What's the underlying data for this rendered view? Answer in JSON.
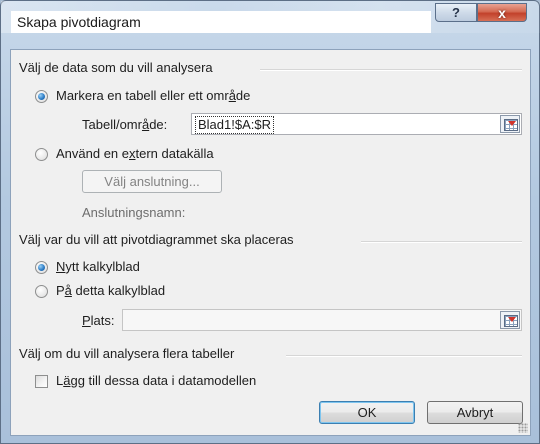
{
  "window": {
    "title": "Skapa pivotdiagram",
    "help_glyph": "?",
    "close_glyph": "x"
  },
  "data_group": {
    "label": "Välj de data som du vill analysera",
    "option_select": {
      "pre": "Markera en tabell eller ett omr",
      "accel": "å",
      "post": "de",
      "selected": true
    },
    "table_range": {
      "pre": "Tabell/omr",
      "accel": "å",
      "post": "de:",
      "value": "Blad1!$A:$R"
    },
    "option_external": {
      "pre": "Använd en e",
      "accel": "x",
      "post": "tern datakälla",
      "selected": false
    },
    "choose_connection_button": "Välj anslutning...",
    "connection_name_label": "Anslutningsnamn:"
  },
  "placement_group": {
    "label": "Välj var du vill att pivotdiagrammet ska placeras",
    "option_new_sheet": {
      "pre": "",
      "accel": "N",
      "post": "ytt kalkylblad",
      "selected": true
    },
    "option_this_sheet": {
      "pre": "P",
      "accel": "å",
      "post": " detta kalkylblad",
      "selected": false
    },
    "location": {
      "pre": "",
      "accel": "P",
      "post": "lats:",
      "value": ""
    }
  },
  "multi_group": {
    "label": "Välj om du vill analysera flera tabeller",
    "add_to_model": {
      "pre": "L",
      "accel": "ä",
      "post": "gg till dessa data i datamodellen",
      "checked": false
    }
  },
  "buttons": {
    "ok": "OK",
    "cancel": "Avbryt"
  }
}
